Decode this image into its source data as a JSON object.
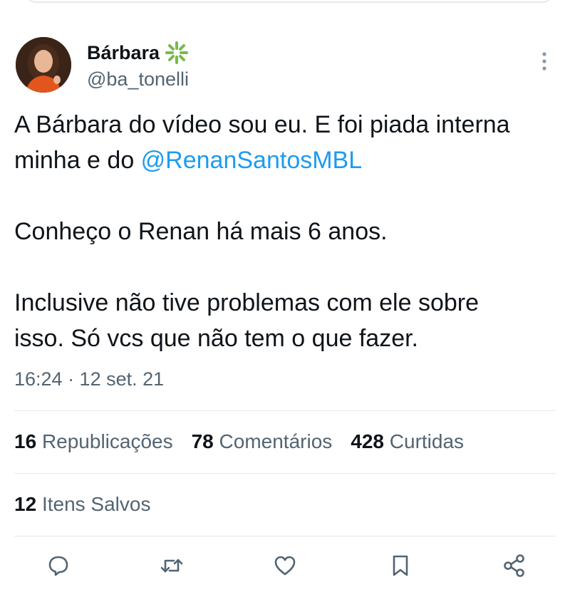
{
  "author": {
    "display_name": "Bárbara",
    "handle": "@ba_tonelli",
    "badge_icon": "verified-asterisk-icon",
    "badge_color": "#78b94a"
  },
  "tweet": {
    "line1": "A Bárbara do vídeo sou eu. E foi piada interna",
    "line2_prefix": "minha e do ",
    "mention": "@RenanSantosMBL",
    "line3": "Conheço o Renan há mais 6 anos.",
    "line4": "Inclusive não tive problemas com ele sobre",
    "line5": "isso. Só vcs que não tem o que fazer."
  },
  "timestamp": "16:24 · 12 set. 21",
  "stats": {
    "reposts_count": "16",
    "reposts_label": "Republicações",
    "comments_count": "78",
    "comments_label": "Comentários",
    "likes_count": "428",
    "likes_label": "Curtidas"
  },
  "saved": {
    "count": "12",
    "label": "Itens Salvos"
  },
  "actions": [
    "reply-icon",
    "retweet-icon",
    "like-icon",
    "bookmark-icon",
    "share-icon"
  ],
  "colors": {
    "text": "#0f1419",
    "secondary": "#536471",
    "link": "#1d9bf0",
    "divider": "#e4e7ea"
  }
}
